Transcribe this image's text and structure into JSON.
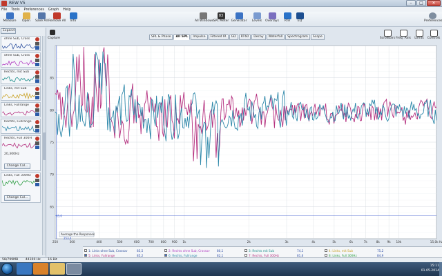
{
  "window": {
    "title": "REW V5"
  },
  "menu": [
    "File",
    "Tools",
    "Preferences",
    "Graph",
    "Help"
  ],
  "toolbar_left": [
    {
      "key": "measure",
      "label": "Measure",
      "icon": "measure-icon",
      "color": "#3b73c4"
    },
    {
      "key": "open",
      "label": "Open",
      "icon": "folder-open-icon",
      "color": "#e0b24a"
    },
    {
      "key": "save_all",
      "label": "Save All",
      "icon": "save-icon",
      "color": "#5577aa"
    },
    {
      "key": "remove_all",
      "label": "Remove All",
      "icon": "remove-all-icon",
      "color": "#c0392b"
    },
    {
      "key": "info",
      "label": "Info",
      "icon": "info-icon",
      "color": "#2a73c9"
    }
  ],
  "toolbar_center": [
    {
      "key": "rta_windows",
      "label": "All Windows",
      "icon": "windows-icon",
      "color": "#777777"
    },
    {
      "key": "spl_meter",
      "label": "SPL Meter",
      "icon": "spl-meter-icon",
      "color": "#333333",
      "value": "83"
    },
    {
      "key": "generator",
      "label": "Generator",
      "icon": "generator-icon",
      "color": "#3b73c4"
    },
    {
      "key": "levels",
      "label": "Levels",
      "icon": "levels-icon",
      "color": "#7a9bd0"
    },
    {
      "key": "overlays",
      "label": "Overlays",
      "icon": "overlays-icon",
      "color": "#7a6fbf"
    },
    {
      "key": "rta",
      "label": "RTA",
      "icon": "rta-icon",
      "color": "#2a73c9"
    },
    {
      "key": "eq",
      "label": "EQ",
      "icon": "eq-icon",
      "color": "#1d4f91"
    }
  ],
  "toolbar_right": [
    {
      "key": "scrollbars",
      "label": "Scrollbars",
      "icon": "scrollbars-icon"
    },
    {
      "key": "freq_axis",
      "label": "Freq. Axis",
      "icon": "freq-axis-icon"
    },
    {
      "key": "limits",
      "label": "Limits",
      "icon": "limits-icon"
    },
    {
      "key": "controls",
      "label": "Controls",
      "icon": "controls-icon"
    }
  ],
  "preferences_label": "Preferences",
  "capture_label": "Capture",
  "expand_label": "Expand",
  "change_cal_label": "Change Cal...",
  "graph_tabs": [
    "SPL & Phase",
    "All SPL",
    "Impulse",
    "Filtered IR",
    "GD",
    "RT60",
    "Decay",
    "Waterfall",
    "Spectrogram",
    "Scope"
  ],
  "active_tab": "All SPL",
  "measurements": [
    {
      "name": "ohne Sub, Cross",
      "color": "#2c4f9e"
    },
    {
      "name": "ohne Sub, Cross",
      "color": "#b13cc2"
    },
    {
      "name": "Rechts, mit Sub",
      "color": "#1e8f8c"
    },
    {
      "name": "Links, mit Sub",
      "color": "#c9a227"
    },
    {
      "name": "Links, Fullrange",
      "color": "#b5307f"
    },
    {
      "name": "Rechts, Fullrange",
      "color": "#2a86a8"
    },
    {
      "name": "Rechts, Full 300Hz",
      "color": "#b5307f",
      "extra": "20,300Hz"
    },
    {
      "name": "Links, Full 300Hz",
      "color": "#2e9e44"
    }
  ],
  "graph": {
    "y_ticks": [
      "85",
      "80",
      "75",
      "70",
      "65"
    ],
    "x_ticks": [
      {
        "f": 250,
        "l": "250"
      },
      {
        "f": 300,
        "l": "300"
      },
      {
        "f": 400,
        "l": "400"
      },
      {
        "f": 500,
        "l": "500"
      },
      {
        "f": 600,
        "l": "600"
      },
      {
        "f": 700,
        "l": "700"
      },
      {
        "f": 800,
        "l": "800"
      },
      {
        "f": 900,
        "l": "900"
      },
      {
        "f": 1000,
        "l": "1k"
      },
      {
        "f": 2000,
        "l": "2k"
      },
      {
        "f": 3000,
        "l": "3k"
      },
      {
        "f": 4000,
        "l": "4k"
      },
      {
        "f": 5000,
        "l": "5k"
      },
      {
        "f": 6000,
        "l": "6k"
      },
      {
        "f": 7000,
        "l": "7k"
      },
      {
        "f": 8000,
        "l": "8k"
      },
      {
        "f": 9000,
        "l": "9k"
      },
      {
        "f": 10000,
        "l": "10k"
      },
      {
        "f": 15000,
        "l": "15,0k Hz"
      }
    ],
    "average_button": "Average the Responses",
    "marker_label": "253,4",
    "level_label": "65,0"
  },
  "legend": [
    {
      "label": "1: Links ohne Sub, Crossov",
      "value": "85,5",
      "color": "#2c4f9e",
      "checked": false
    },
    {
      "label": "2: Rechts ohne Sub, Crossov",
      "value": "80,1",
      "color": "#b13cc2",
      "checked": false
    },
    {
      "label": "3: Rechts mit Sub",
      "value": "74,1",
      "color": "#1e8f8c",
      "checked": false
    },
    {
      "label": "4: Links, mit Sub",
      "value": "75,2",
      "color": "#c9a227",
      "checked": false
    },
    {
      "label": "5: Links, Fullrange",
      "value": "85,2",
      "color": "#b5307f",
      "checked": true
    },
    {
      "label": "6: Rechts, Fullrange",
      "value": "82,1",
      "color": "#2a86a8",
      "checked": true
    },
    {
      "label": "7: Rechts, Full 300Hz",
      "value": "81,6",
      "color": "#b5307f",
      "checked": false
    },
    {
      "label": "8: Links, Full 300Hz",
      "value": "84,9",
      "color": "#2e9e44",
      "checked": false
    }
  ],
  "status": [
    "58/799MB",
    "44100 Hz",
    "16 Bit"
  ],
  "tray": {
    "time": "15:11",
    "date": "01.05.2014"
  },
  "series": {
    "links_fullrange": {
      "color": "#b5307f",
      "seed": 7
    },
    "rechts_fullrange": {
      "color": "#2a86a8",
      "seed": 3
    }
  }
}
